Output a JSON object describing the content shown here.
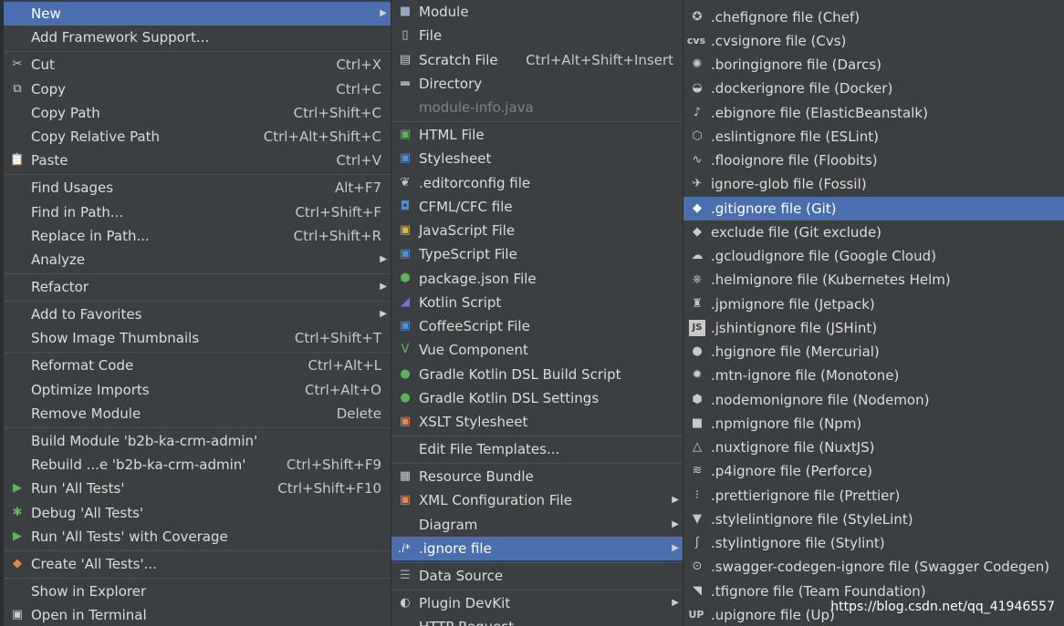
{
  "menu1": {
    "items": [
      {
        "label": "New",
        "shortcut": "",
        "icon": "",
        "submenu": true,
        "selected": true
      },
      {
        "label": "Add Framework Support...",
        "shortcut": "",
        "icon": ""
      },
      {
        "label": "Cut",
        "shortcut": "Ctrl+X",
        "icon": "scissors-icon"
      },
      {
        "label": "Copy",
        "shortcut": "Ctrl+C",
        "icon": "copy-icon"
      },
      {
        "label": "Copy Path",
        "shortcut": "Ctrl+Shift+C",
        "icon": ""
      },
      {
        "label": "Copy Relative Path",
        "shortcut": "Ctrl+Alt+Shift+C",
        "icon": ""
      },
      {
        "label": "Paste",
        "shortcut": "Ctrl+V",
        "icon": "paste-icon"
      },
      {
        "label": "Find Usages",
        "shortcut": "Alt+F7",
        "icon": ""
      },
      {
        "label": "Find in Path...",
        "shortcut": "Ctrl+Shift+F",
        "icon": ""
      },
      {
        "label": "Replace in Path...",
        "shortcut": "Ctrl+Shift+R",
        "icon": ""
      },
      {
        "label": "Analyze",
        "shortcut": "",
        "icon": "",
        "submenu": true
      },
      {
        "label": "Refactor",
        "shortcut": "",
        "icon": "",
        "submenu": true
      },
      {
        "label": "Add to Favorites",
        "shortcut": "",
        "icon": "",
        "submenu": true
      },
      {
        "label": "Show Image Thumbnails",
        "shortcut": "Ctrl+Shift+T",
        "icon": ""
      },
      {
        "label": "Reformat Code",
        "shortcut": "Ctrl+Alt+L",
        "icon": ""
      },
      {
        "label": "Optimize Imports",
        "shortcut": "Ctrl+Alt+O",
        "icon": ""
      },
      {
        "label": "Remove Module",
        "shortcut": "Delete",
        "icon": ""
      },
      {
        "label": "Build Module 'b2b-ka-crm-admin'",
        "shortcut": "",
        "icon": ""
      },
      {
        "label": "Rebuild ...e 'b2b-ka-crm-admin'",
        "shortcut": "Ctrl+Shift+F9",
        "icon": ""
      },
      {
        "label": "Run 'All Tests'",
        "shortcut": "Ctrl+Shift+F10",
        "icon": "run-icon"
      },
      {
        "label": "Debug 'All Tests'",
        "shortcut": "",
        "icon": "debug-icon"
      },
      {
        "label": "Run 'All Tests' with Coverage",
        "shortcut": "",
        "icon": "coverage-icon"
      },
      {
        "label": "Create 'All Tests'...",
        "shortcut": "",
        "icon": "create-test-icon"
      },
      {
        "label": "Show in Explorer",
        "shortcut": "",
        "icon": ""
      },
      {
        "label": "Open in Terminal",
        "shortcut": "",
        "icon": "terminal-icon"
      }
    ]
  },
  "menu2": {
    "items": [
      {
        "label": "Module",
        "shortcut": "",
        "icon": "module-icon"
      },
      {
        "label": "File",
        "shortcut": "",
        "icon": "file-icon"
      },
      {
        "label": "Scratch File",
        "shortcut": "Ctrl+Alt+Shift+Insert",
        "icon": "scratch-file-icon"
      },
      {
        "label": "Directory",
        "shortcut": "",
        "icon": "folder-icon"
      },
      {
        "label": "module-info.java",
        "shortcut": "",
        "icon": "",
        "disabled": true
      },
      {
        "label": "HTML File",
        "shortcut": "",
        "icon": "html-icon"
      },
      {
        "label": "Stylesheet",
        "shortcut": "",
        "icon": "css-icon"
      },
      {
        "label": ".editorconfig file",
        "shortcut": "",
        "icon": "editorconfig-icon"
      },
      {
        "label": "CFML/CFC file",
        "shortcut": "",
        "icon": "cfml-icon"
      },
      {
        "label": "JavaScript File",
        "shortcut": "",
        "icon": "javascript-icon"
      },
      {
        "label": "TypeScript File",
        "shortcut": "",
        "icon": "typescript-icon"
      },
      {
        "label": "package.json File",
        "shortcut": "",
        "icon": "nodejs-icon"
      },
      {
        "label": "Kotlin Script",
        "shortcut": "",
        "icon": "kotlin-icon"
      },
      {
        "label": "CoffeeScript File",
        "shortcut": "",
        "icon": "coffeescript-icon"
      },
      {
        "label": "Vue Component",
        "shortcut": "",
        "icon": "vue-icon"
      },
      {
        "label": "Gradle Kotlin DSL Build Script",
        "shortcut": "",
        "icon": "gradle-icon"
      },
      {
        "label": "Gradle Kotlin DSL Settings",
        "shortcut": "",
        "icon": "gradle-icon"
      },
      {
        "label": "XSLT Stylesheet",
        "shortcut": "",
        "icon": "xslt-icon"
      },
      {
        "label": "Edit File Templates...",
        "shortcut": "",
        "icon": ""
      },
      {
        "label": "Resource Bundle",
        "shortcut": "",
        "icon": "resource-bundle-icon"
      },
      {
        "label": "XML Configuration File",
        "shortcut": "",
        "icon": "xml-icon",
        "submenu": true
      },
      {
        "label": "Diagram",
        "shortcut": "",
        "icon": "",
        "submenu": true
      },
      {
        "label": ".ignore file",
        "shortcut": "",
        "icon": "ignore-icon",
        "submenu": true,
        "selected": true
      },
      {
        "label": "Data Source",
        "shortcut": "",
        "icon": "database-icon"
      },
      {
        "label": "Plugin DevKit",
        "shortcut": "",
        "icon": "plugin-icon",
        "submenu": true
      },
      {
        "label": "HTTP Request",
        "shortcut": "",
        "icon": ""
      }
    ],
    "ignore_icon_text": ".i*"
  },
  "menu3": {
    "items": [
      {
        "label": ".chefignore file (Chef)",
        "icon": "chef-icon"
      },
      {
        "label": ".cvsignore file (Cvs)",
        "icon": "cvs-icon",
        "icon_text": "cvs"
      },
      {
        "label": ".boringignore file (Darcs)",
        "icon": "darcs-icon"
      },
      {
        "label": ".dockerignore file (Docker)",
        "icon": "docker-icon"
      },
      {
        "label": ".ebignore file (ElasticBeanstalk)",
        "icon": "elasticbeanstalk-icon"
      },
      {
        "label": ".eslintignore file (ESLint)",
        "icon": "eslint-icon"
      },
      {
        "label": ".flooignore file (Floobits)",
        "icon": "floobits-icon"
      },
      {
        "label": "ignore-glob file (Fossil)",
        "icon": "fossil-icon"
      },
      {
        "label": ".gitignore file (Git)",
        "icon": "git-icon",
        "selected": true
      },
      {
        "label": "exclude file (Git exclude)",
        "icon": "git-exclude-icon"
      },
      {
        "label": ".gcloudignore file (Google Cloud)",
        "icon": "google-cloud-icon"
      },
      {
        "label": ".helmignore file (Kubernetes Helm)",
        "icon": "helm-icon"
      },
      {
        "label": ".jpmignore file (Jetpack)",
        "icon": "jetpack-icon"
      },
      {
        "label": ".jshintignore file (JSHint)",
        "icon": "jshint-icon",
        "icon_text": "JS"
      },
      {
        "label": ".hgignore file (Mercurial)",
        "icon": "mercurial-icon"
      },
      {
        "label": ".mtn-ignore file (Monotone)",
        "icon": "monotone-icon"
      },
      {
        "label": ".nodemonignore file (Nodemon)",
        "icon": "nodemon-icon"
      },
      {
        "label": ".npmignore file (Npm)",
        "icon": "npm-icon"
      },
      {
        "label": ".nuxtignore file (NuxtJS)",
        "icon": "nuxtjs-icon"
      },
      {
        "label": ".p4ignore file (Perforce)",
        "icon": "perforce-icon"
      },
      {
        "label": ".prettierignore file (Prettier)",
        "icon": "prettier-icon"
      },
      {
        "label": ".stylelintignore file (StyleLint)",
        "icon": "stylelint-icon"
      },
      {
        "label": ".stylintignore file (Stylint)",
        "icon": "stylint-icon"
      },
      {
        "label": ".swagger-codegen-ignore file (Swagger Codegen)",
        "icon": "swagger-icon"
      },
      {
        "label": ".tfignore file (Team Foundation)",
        "icon": "team-foundation-icon"
      },
      {
        "label": ".upignore file (Up)",
        "icon": "up-icon",
        "icon_text": "UP"
      }
    ]
  },
  "watermark": "https://blog.csdn.net/qq_41946557",
  "colors": {
    "menu_bg": "#3c3f41",
    "selection": "#4b6eaf",
    "text": "#dcdcdc",
    "separator": "#515151"
  }
}
